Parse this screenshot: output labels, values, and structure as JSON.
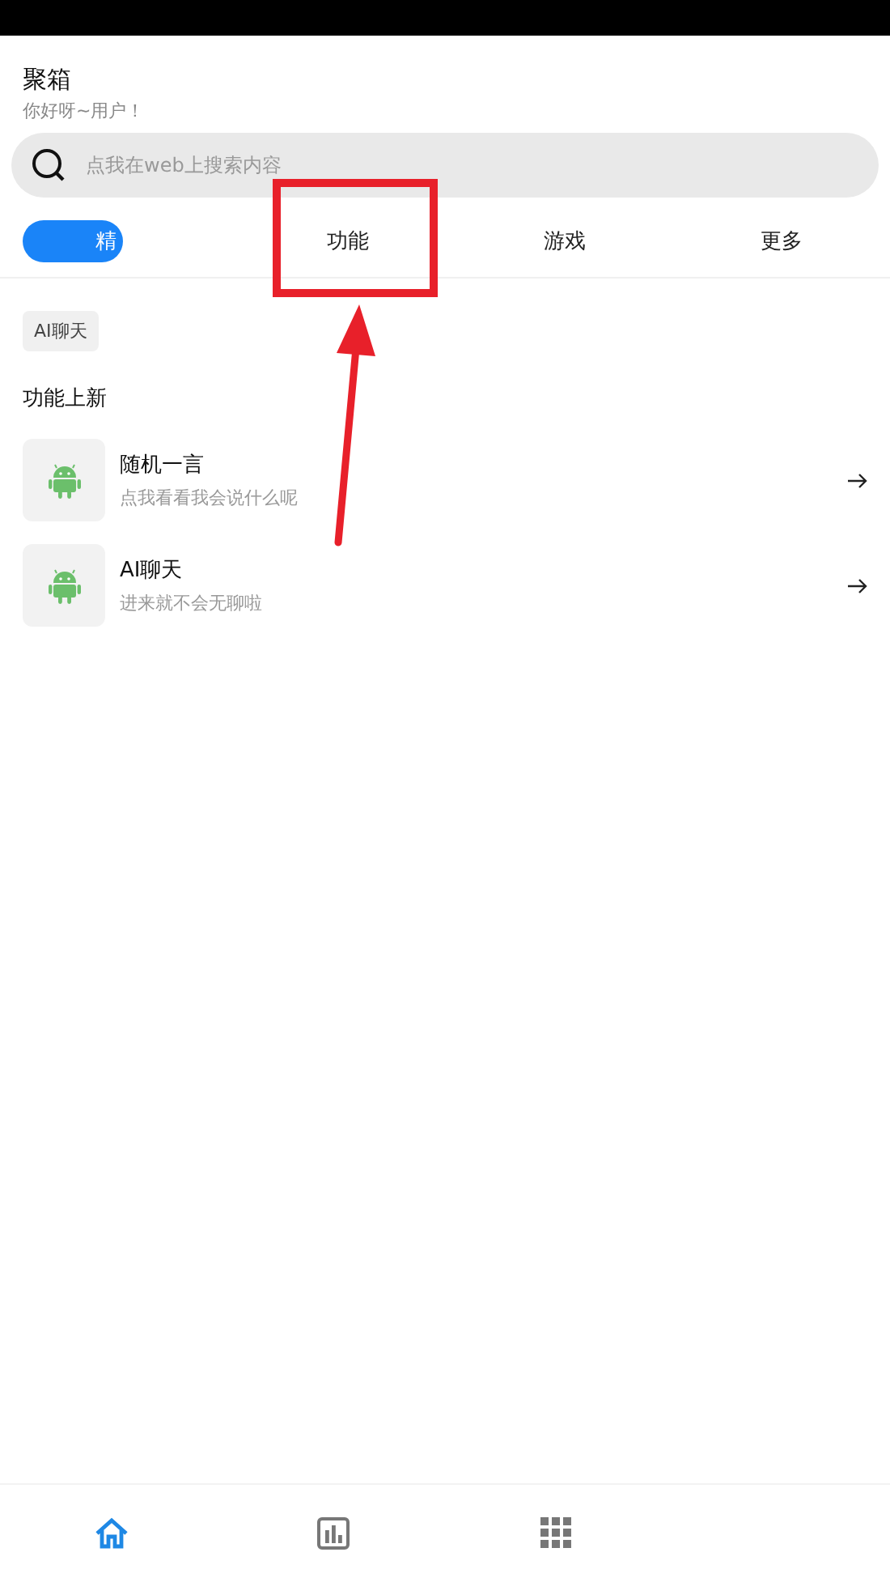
{
  "header": {
    "title": "聚箱",
    "subtitle": "你好呀~用户！"
  },
  "search": {
    "placeholder": "点我在web上搜索内容"
  },
  "tabs": [
    {
      "label": "精",
      "selected": true
    },
    {
      "label": "功能",
      "selected": false
    },
    {
      "label": "游戏",
      "selected": false
    },
    {
      "label": "更多",
      "selected": false
    }
  ],
  "chips": [
    "AI聊天"
  ],
  "section_title": "功能上新",
  "items": [
    {
      "title": "随机一言",
      "subtitle": "点我看看我会说什么呢"
    },
    {
      "title": "AI聊天",
      "subtitle": "进来就不会无聊啦"
    }
  ],
  "bottom_nav": [
    {
      "kind": "home",
      "selected": true
    },
    {
      "kind": "chart",
      "selected": false
    },
    {
      "kind": "apps",
      "selected": false
    }
  ]
}
